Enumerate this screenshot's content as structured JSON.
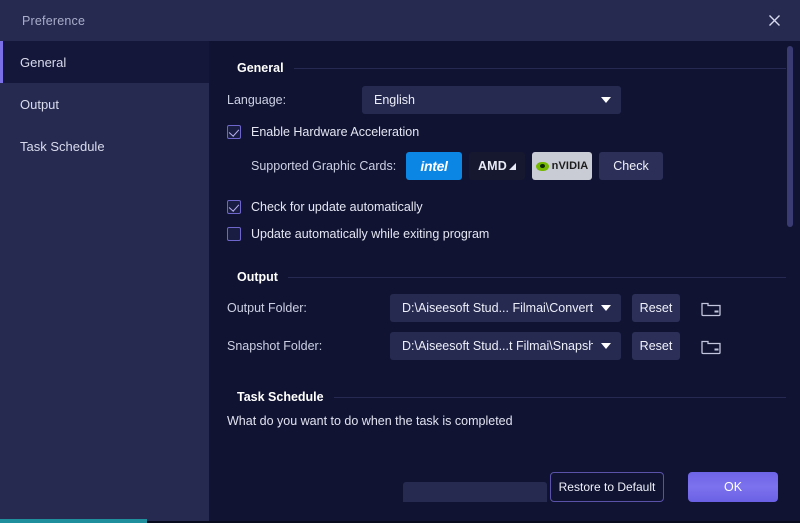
{
  "window": {
    "title": "Preference",
    "close_icon": "close-icon"
  },
  "sidebar": {
    "items": [
      {
        "label": "General",
        "active": true
      },
      {
        "label": "Output",
        "active": false
      },
      {
        "label": "Task Schedule",
        "active": false
      }
    ]
  },
  "general": {
    "heading": "General",
    "language_label": "Language:",
    "language_value": "English",
    "hardware_accel": {
      "label": "Enable Hardware Acceleration",
      "checked": true
    },
    "graphic_cards_label": "Supported Graphic Cards:",
    "cards": [
      {
        "name": "intel",
        "icon": "intel-logo"
      },
      {
        "name": "AMD",
        "icon": "amd-logo"
      },
      {
        "name": "nVIDIA",
        "icon": "nvidia-logo"
      }
    ],
    "check_button": "Check",
    "check_update": {
      "label": "Check for update automatically",
      "checked": true
    },
    "update_on_exit": {
      "label": "Update automatically while exiting program",
      "checked": false
    }
  },
  "output": {
    "heading": "Output",
    "output_folder_label": "Output Folder:",
    "output_folder_value": "D:\\Aiseesoft Stud... Filmai\\Converted",
    "snapshot_folder_label": "Snapshot Folder:",
    "snapshot_folder_value": "D:\\Aiseesoft Stud...t Filmai\\Snapshot",
    "reset_label": "Reset",
    "browse_icon": "folder-icon"
  },
  "task_schedule": {
    "heading": "Task Schedule",
    "question": "What do you want to do when the task is completed"
  },
  "footer": {
    "restore_label": "Restore to Default",
    "ok_label": "OK"
  },
  "colors": {
    "accent": "#7b6fe8",
    "ok_button": "#6d63e6",
    "intel_blue": "#0b86e4",
    "nvidia_green": "#76b900",
    "teal_strip": "#1f8f9e",
    "panel_bg": "#101331",
    "sidebar_bg": "#262a51"
  }
}
